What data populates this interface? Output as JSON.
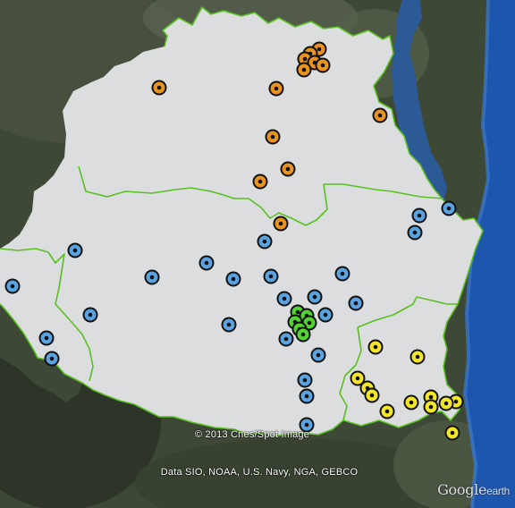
{
  "attribution": {
    "line1": "© 2013 Cnes/Spot Image",
    "line2": "Data SIO, NOAA, U.S. Navy, NGA, GEBCO"
  },
  "logo": {
    "brand": "Google",
    "product": "earth"
  },
  "colors": {
    "terrain": "#3f4a37",
    "ocean": "#1f56ad",
    "region_fill": "#dcdddf",
    "boundary": "#5ac021",
    "marker_outline": "#111111",
    "groups": {
      "orange": "#e8931f",
      "blue": "#5aa2e0",
      "green": "#51d430",
      "yellow": "#f2e52a"
    }
  },
  "marker_groups": [
    "orange",
    "blue",
    "green",
    "yellow"
  ],
  "marker_icon": "circle-dot-marker"
}
